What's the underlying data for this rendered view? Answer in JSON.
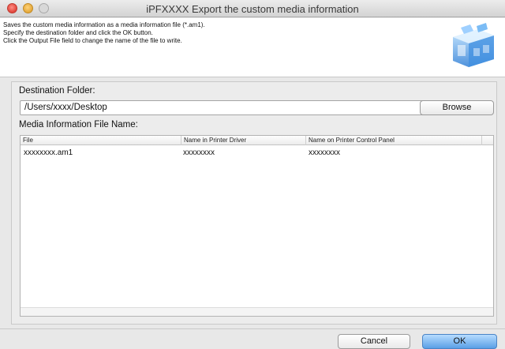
{
  "window": {
    "title": "iPFXXXX Export the custom media information"
  },
  "header": {
    "description_lines": [
      "Saves the custom media information as a media information file (*.am1).",
      "Specify the destination folder and click the OK button.",
      "Click the Output File field to change the name of the file to write."
    ]
  },
  "destination": {
    "label": "Destination Folder:",
    "path": "/Users/xxxx/Desktop",
    "browse_label": "Browse"
  },
  "media_info": {
    "label": "Media Information File Name:",
    "columns": [
      "File",
      "Name in Printer Driver",
      "Name on Printer Control Panel"
    ],
    "rows": [
      [
        "xxxxxxxx.am1",
        "xxxxxxxx",
        "xxxxxxxx"
      ]
    ]
  },
  "footer": {
    "cancel_label": "Cancel",
    "ok_label": "OK"
  },
  "colors": {
    "ok_button": "#6aa8e8",
    "window_bg": "#e8e8e8"
  },
  "icons": [
    "close-icon",
    "minimize-icon",
    "maximize-icon",
    "printer-media-illustration"
  ]
}
